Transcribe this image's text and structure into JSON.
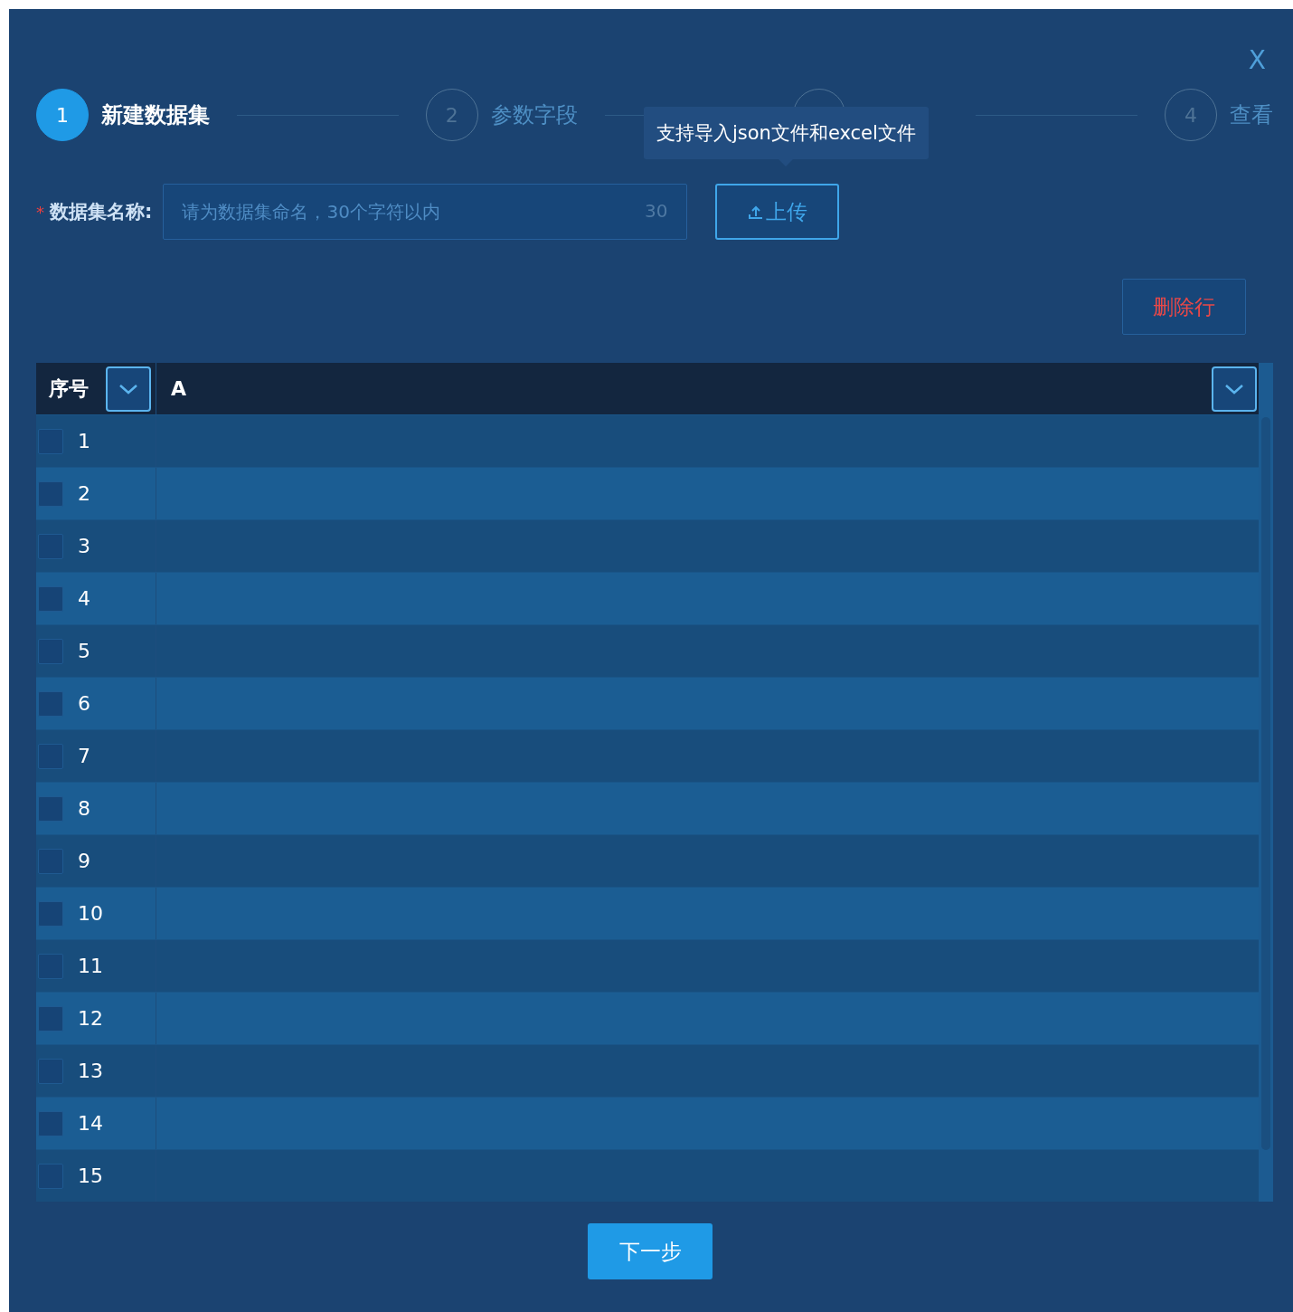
{
  "dialog": {
    "close": "X"
  },
  "steps": [
    {
      "number": "1",
      "label": "新建数据集",
      "selected": true
    },
    {
      "number": "2",
      "label": "参数字段",
      "selected": false
    },
    {
      "selected": false
    },
    {
      "number": "4",
      "label": "查看",
      "selected": false
    }
  ],
  "tooltip": "支持导入json文件和excel文件",
  "name_field": {
    "required": true,
    "required_mark": "*",
    "label": "数据集名称:",
    "placeholder": "请为数据集命名，30个字符以内",
    "counter": "30"
  },
  "upload_button": "上传",
  "delete_row_button": "删除行",
  "table": {
    "columns": [
      "序号",
      "A"
    ],
    "rows": [
      {
        "index": "1",
        "checked": false
      },
      {
        "index": "2",
        "checked": false
      },
      {
        "index": "3",
        "checked": false
      },
      {
        "index": "4",
        "checked": false
      },
      {
        "index": "5",
        "checked": false
      },
      {
        "index": "6",
        "checked": false
      },
      {
        "index": "7",
        "checked": false
      },
      {
        "index": "8",
        "checked": false
      },
      {
        "index": "9",
        "checked": false
      },
      {
        "index": "10",
        "checked": false
      },
      {
        "index": "11",
        "checked": false
      },
      {
        "index": "12",
        "checked": false
      },
      {
        "index": "13",
        "checked": false
      },
      {
        "index": "14",
        "checked": false
      },
      {
        "index": "15",
        "checked": false
      }
    ]
  },
  "next_button": "下一步"
}
